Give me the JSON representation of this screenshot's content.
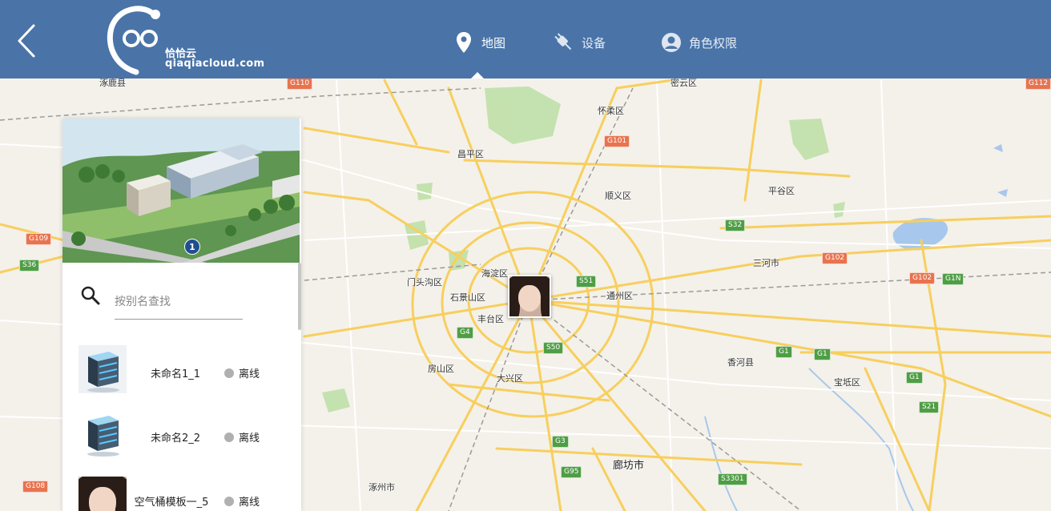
{
  "header": {
    "back_icon": "chevron-left-icon",
    "logo": {
      "name": "恰恰云",
      "domain": "qiaqiacloud.com"
    },
    "nav": [
      {
        "label": "地图",
        "icon": "map-pin-icon",
        "active": true
      },
      {
        "label": "设备",
        "icon": "plug-icon",
        "active": false
      },
      {
        "label": "角色权限",
        "icon": "user-circle-icon",
        "active": false
      }
    ],
    "background": "#4a74a8"
  },
  "panel": {
    "banner_badge": "1",
    "search": {
      "placeholder": "按别名查找",
      "value": ""
    },
    "devices": [
      {
        "name": "未命名1_1",
        "status": "离线",
        "thumb": "server-icon"
      },
      {
        "name": "未命名2_2",
        "status": "离线",
        "thumb": "server-icon"
      },
      {
        "name": "空气桶模板一_5",
        "status": "离线",
        "thumb": "person-photo"
      }
    ],
    "offline_color": "#b0b0b0"
  },
  "map": {
    "places": [
      {
        "name": "涿鹿县",
        "big": false
      },
      {
        "name": "密云区",
        "big": false
      },
      {
        "name": "怀柔区",
        "big": false
      },
      {
        "name": "昌平区",
        "big": false
      },
      {
        "name": "顺义区",
        "big": false
      },
      {
        "name": "平谷区",
        "big": false
      },
      {
        "name": "三河市",
        "big": false
      },
      {
        "name": "海淀区",
        "big": false
      },
      {
        "name": "门头沟区",
        "big": false
      },
      {
        "name": "石景山区",
        "big": false
      },
      {
        "name": "丰台区",
        "big": false
      },
      {
        "name": "通州区",
        "big": false
      },
      {
        "name": "房山区",
        "big": false
      },
      {
        "name": "大兴区",
        "big": false
      },
      {
        "name": "香河县",
        "big": false
      },
      {
        "name": "宝坻区",
        "big": false
      },
      {
        "name": "廊坊市",
        "big": true
      },
      {
        "name": "涿州市",
        "big": false
      }
    ],
    "shields": [
      {
        "code": "G110",
        "color": "red"
      },
      {
        "code": "G101",
        "color": "red"
      },
      {
        "code": "G112",
        "color": "red"
      },
      {
        "code": "G109",
        "color": "red"
      },
      {
        "code": "S36",
        "color": "green"
      },
      {
        "code": "S32",
        "color": "green"
      },
      {
        "code": "G102",
        "color": "red"
      },
      {
        "code": "G102",
        "color": "red"
      },
      {
        "code": "G1N",
        "color": "green"
      },
      {
        "code": "S51",
        "color": "green"
      },
      {
        "code": "G4",
        "color": "green"
      },
      {
        "code": "S50",
        "color": "green"
      },
      {
        "code": "G1",
        "color": "green"
      },
      {
        "code": "G1",
        "color": "green"
      },
      {
        "code": "G1",
        "color": "green"
      },
      {
        "code": "S21",
        "color": "green"
      },
      {
        "code": "G3",
        "color": "green"
      },
      {
        "code": "G95",
        "color": "green"
      },
      {
        "code": "S3301",
        "color": "green"
      },
      {
        "code": "G108",
        "color": "red"
      }
    ],
    "marker": "person-photo"
  }
}
